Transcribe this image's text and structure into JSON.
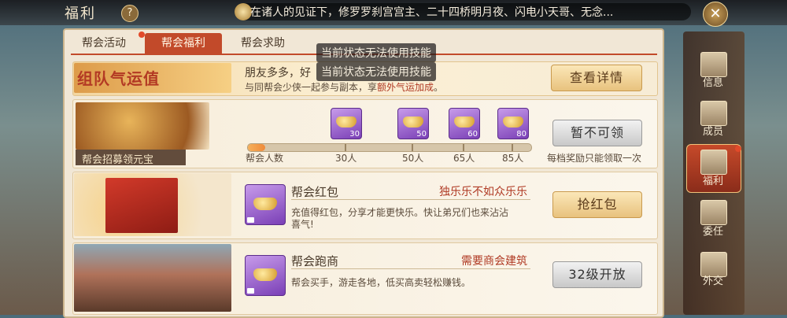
{
  "header": {
    "title": "福利",
    "help_icon": "?",
    "marquee": "在诸人的见证下，修罗罗刹宫宫主、二十四桥明月夜、闪电小天哥、无念...",
    "close_icon": "✕"
  },
  "tabs": [
    {
      "label": "帮会活动",
      "active": false
    },
    {
      "label": "帮会福利",
      "active": true
    },
    {
      "label": "帮会求助",
      "active": false
    }
  ],
  "toasts": [
    "当前状态无法使用技能",
    "当前状态无法使用技能"
  ],
  "team_luck": {
    "banner_title": "组队气运值",
    "line1": "朋友多多，好",
    "line2_prefix": "与同帮会少侠一起参与副本，享",
    "line2_highlight": "额外气运加成",
    "line2_suffix": "。",
    "button": "查看详情"
  },
  "recruit": {
    "label": "帮会招募领元宝",
    "progress_label": "帮会人数",
    "progress": 0.06,
    "milestones": [
      {
        "label": "30人",
        "count": "30"
      },
      {
        "label": "50人",
        "count": "50"
      },
      {
        "label": "65人",
        "count": "60"
      },
      {
        "label": "85人",
        "count": "80"
      }
    ],
    "button": "暂不可领",
    "note": "每档奖励只能领取一次"
  },
  "red_packet": {
    "title": "帮会红包",
    "tag": "独乐乐不如众乐乐",
    "desc1": "充值得红包，分享才能更快乐。快让弟兄们也来沾沾",
    "desc2": "喜气!",
    "button": "抢红包"
  },
  "trade": {
    "title": "帮会跑商",
    "tag": "需要商会建筑",
    "desc": "帮会买手，游走各地，低买高卖轻松赚钱。",
    "button": "32级开放"
  },
  "nav": [
    "信息",
    "成员",
    "福利",
    "委任",
    "外交"
  ],
  "colors": {
    "accent": "#c24a2a",
    "panel": "#f1e7d6",
    "item_purple": "#7a3fb6"
  }
}
